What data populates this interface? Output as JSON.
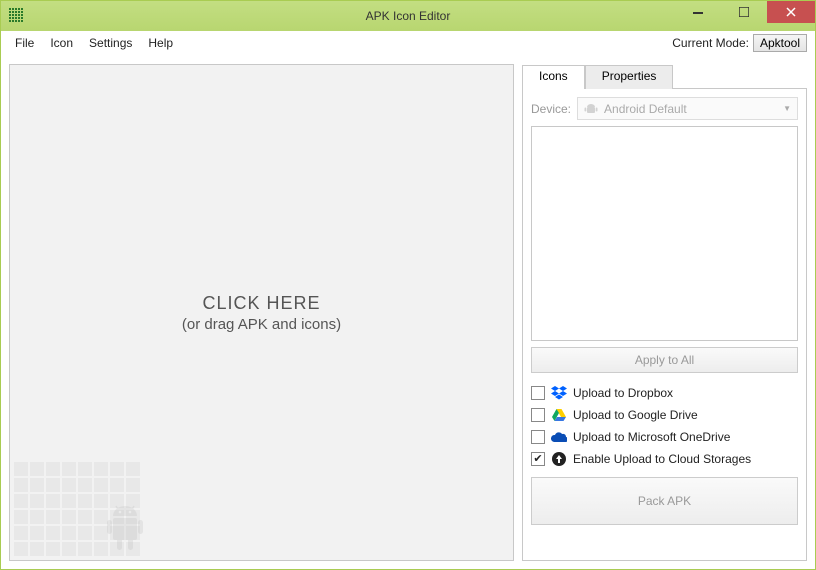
{
  "window": {
    "title": "APK Icon Editor"
  },
  "menu": {
    "file": "File",
    "icon": "Icon",
    "settings": "Settings",
    "help": "Help",
    "mode_label": "Current Mode:",
    "mode_value": "Apktool"
  },
  "drop": {
    "line1": "CLICK HERE",
    "line2": "(or drag APK and icons)"
  },
  "tabs": {
    "icons": "Icons",
    "properties": "Properties"
  },
  "device": {
    "label": "Device:",
    "value": "Android Default"
  },
  "buttons": {
    "apply_all": "Apply to All",
    "pack": "Pack APK"
  },
  "uploads": {
    "dropbox": {
      "label": "Upload to Dropbox",
      "checked": false
    },
    "gdrive": {
      "label": "Upload to Google Drive",
      "checked": false
    },
    "onedrive": {
      "label": "Upload to Microsoft OneDrive",
      "checked": false
    },
    "enable": {
      "label": "Enable Upload to Cloud Storages",
      "checked": true
    }
  }
}
